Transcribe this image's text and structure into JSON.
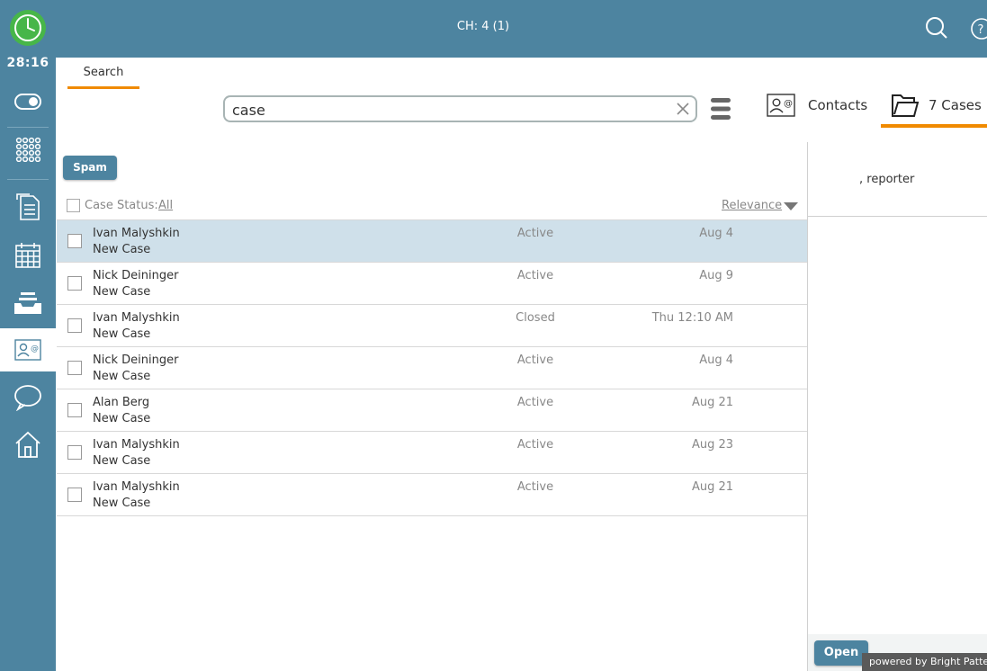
{
  "header": {
    "timer": "28:16",
    "channel_status": "CH: 4 (1)"
  },
  "search": {
    "tab_label": "Search",
    "query": "case"
  },
  "tabs": {
    "contacts_label": "Contacts",
    "cases_label": "7 Cases"
  },
  "toolbar": {
    "spam_label": "Spam"
  },
  "filter": {
    "status_label": "Case Status:",
    "status_value": "All",
    "sort_label": "Relevance"
  },
  "cases": [
    {
      "name": "Ivan Malyshkin",
      "subject": "New Case",
      "status": "Active",
      "date": "Aug 4"
    },
    {
      "name": "Nick Deininger",
      "subject": "New Case",
      "status": "Active",
      "date": "Aug 9"
    },
    {
      "name": "Ivan Malyshkin",
      "subject": "New Case",
      "status": "Closed",
      "date": "Thu 12:10 AM"
    },
    {
      "name": "Nick Deininger",
      "subject": "New Case",
      "status": "Active",
      "date": "Aug 4"
    },
    {
      "name": "Alan Berg",
      "subject": "New Case",
      "status": "Active",
      "date": "Aug 21"
    },
    {
      "name": "Ivan Malyshkin",
      "subject": "New Case",
      "status": "Active",
      "date": "Aug 23"
    },
    {
      "name": "Ivan Malyshkin",
      "subject": "New Case",
      "status": "Active",
      "date": "Aug 21"
    }
  ],
  "detail": {
    "reporter": ", reporter",
    "open_label": "Open",
    "powered_by": "powered by Bright Pattern"
  },
  "icons": {
    "clock": "clock-icon",
    "toggle": "toggle-icon",
    "dialpad": "dialpad-icon",
    "document": "document-icon",
    "calendar": "calendar-icon",
    "inbox": "inbox-icon",
    "contacts": "contact-card-icon",
    "chat": "chat-bubble-icon",
    "home": "home-icon",
    "search": "search-icon",
    "help": "help-icon",
    "folder": "folder-icon"
  },
  "colors": {
    "brand": "#4d84a0",
    "accent": "#f08a00",
    "selected_row": "#cfe0ea",
    "clock_green": "#47b649"
  }
}
